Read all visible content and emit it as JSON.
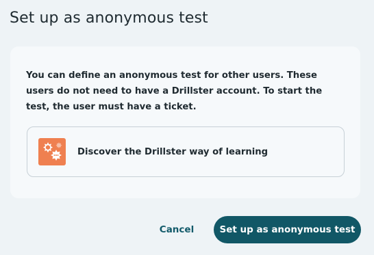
{
  "dialog": {
    "title": "Set up as anonymous test",
    "description": "You can define an anonymous test for other users. These users do not need to have a Drillster account. To start the test, the user must have a ticket.",
    "link_card": {
      "label": "Discover the Drillster way of learning",
      "icon": "speech-bubbles-icon"
    },
    "actions": {
      "cancel_label": "Cancel",
      "confirm_label": "Set up as anonymous test"
    }
  },
  "colors": {
    "background": "#eef3f6",
    "panel": "#f6f9fb",
    "primary": "#115766",
    "link": "#125a6a",
    "icon_bg": "#ef8050"
  }
}
